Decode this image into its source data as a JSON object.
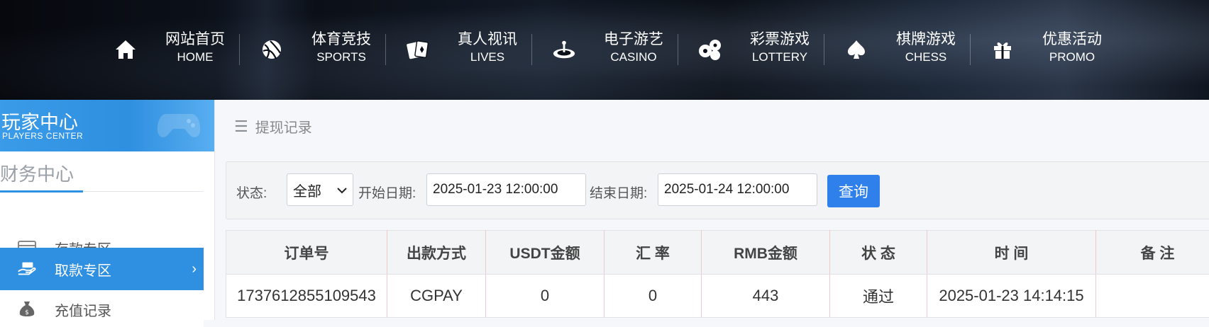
{
  "nav": [
    {
      "cn": "网站首页",
      "en": "HOME",
      "icon": "home-icon"
    },
    {
      "cn": "体育竞技",
      "en": "SPORTS",
      "icon": "ball-icon"
    },
    {
      "cn": "真人视讯",
      "en": "LIVES",
      "icon": "cards-icon"
    },
    {
      "cn": "电子游艺",
      "en": "CASINO",
      "icon": "roulette-icon"
    },
    {
      "cn": "彩票游戏",
      "en": "LOTTERY",
      "icon": "lottery-balls-icon"
    },
    {
      "cn": "棋牌游戏",
      "en": "CHESS",
      "icon": "spade-icon"
    },
    {
      "cn": "优惠活动",
      "en": "PROMO",
      "icon": "gift-icon"
    }
  ],
  "sidebar": {
    "banner_title": "玩家中心",
    "banner_subtitle": "PLAYERS CENTER",
    "section_title": "财务中心",
    "items": [
      {
        "label": "存款专区",
        "icon": "wallet-icon"
      },
      {
        "label": "取款专区",
        "icon": "withdraw-hand-icon",
        "active": true
      },
      {
        "label": "充值记录",
        "icon": "money-bag-icon"
      }
    ]
  },
  "breadcrumb": "提现记录",
  "filter": {
    "status_label": "状态:",
    "status_value": "全部",
    "start_label": "开始日期:",
    "start_value": "2025-01-23 12:00:00",
    "end_label": "结束日期:",
    "end_value": "2025-01-24 12:00:00",
    "query_label": "查询"
  },
  "table": {
    "headers": [
      "订单号",
      "出款方式",
      "USDT金额",
      "汇 率",
      "RMB金额",
      "状 态",
      "时 间",
      "备 注"
    ],
    "rows": [
      [
        "1737612855109543",
        "CGPAY",
        "0",
        "0",
        "443",
        "通过",
        "2025-01-23 14:14:15",
        ""
      ]
    ]
  },
  "colors": {
    "accent": "#2f8fe0",
    "button": "#2f80ea"
  }
}
